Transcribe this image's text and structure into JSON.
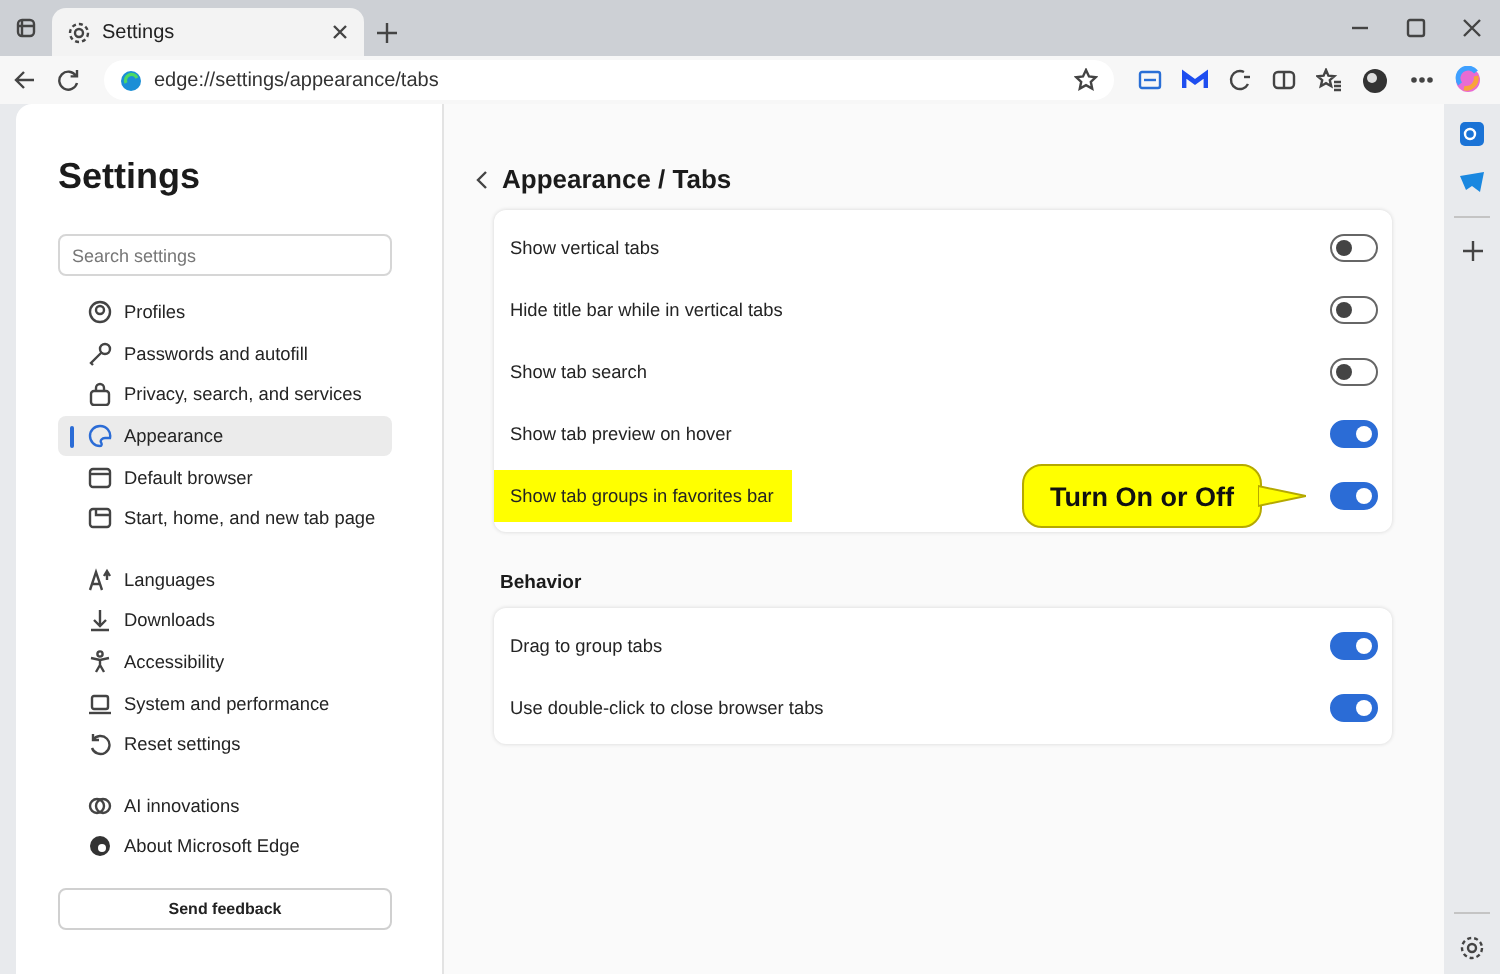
{
  "browser": {
    "tab_title": "Settings",
    "address": "edge://settings/appearance/tabs"
  },
  "nav": {
    "title": "Settings",
    "search": {
      "placeholder": "Search settings"
    },
    "groups": [
      [
        {
          "label": "Profiles",
          "selected": false
        },
        {
          "label": "Passwords and autofill",
          "selected": false
        },
        {
          "label": "Privacy, search, and services",
          "selected": false
        },
        {
          "label": "Appearance",
          "selected": true
        },
        {
          "label": "Default browser",
          "selected": false
        },
        {
          "label": "Start, home, and new tab page",
          "selected": false
        }
      ],
      [
        {
          "label": "Languages",
          "selected": false
        },
        {
          "label": "Downloads",
          "selected": false
        },
        {
          "label": "Accessibility",
          "selected": false
        },
        {
          "label": "System and performance",
          "selected": false
        },
        {
          "label": "Reset settings",
          "selected": false
        }
      ],
      [
        {
          "label": "AI innovations",
          "selected": false
        },
        {
          "label": "About Microsoft Edge",
          "selected": false
        }
      ]
    ],
    "button": "Send feedback"
  },
  "page": {
    "title": "Appearance / Tabs",
    "sections": [
      {
        "rows": [
          {
            "label": "Show vertical tabs",
            "on": false,
            "highlighted": false
          },
          {
            "label": "Hide title bar while in vertical tabs",
            "on": false,
            "highlighted": false
          },
          {
            "label": "Show tab search",
            "on": false,
            "highlighted": false
          },
          {
            "label": "Show tab preview on hover",
            "on": true,
            "highlighted": false
          },
          {
            "label": "Show tab groups in favorites bar",
            "on": true,
            "highlighted": true
          }
        ]
      },
      {
        "heading": "Behavior",
        "rows": [
          {
            "label": "Drag to group tabs",
            "on": true,
            "highlighted": false
          },
          {
            "label": "Use double-click to close browser tabs",
            "on": true,
            "highlighted": false
          }
        ]
      }
    ],
    "callout": {
      "text": "Turn On or Off"
    }
  }
}
